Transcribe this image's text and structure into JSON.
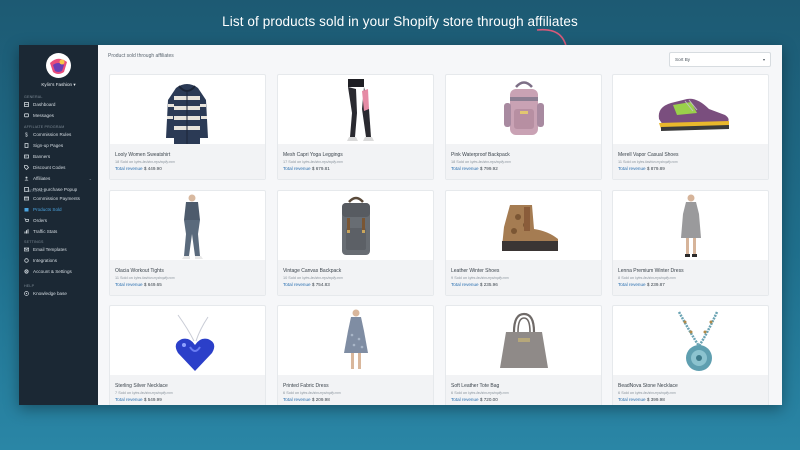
{
  "headline": "List of products sold in your Shopify store through affiliates",
  "sidebar": {
    "store_name": "Kylin's Fashion ▾",
    "sections": [
      {
        "title": "GENERAL",
        "items": [
          {
            "label": "Dashboard",
            "icon": "dashboard-icon",
            "active": false
          },
          {
            "label": "Messages",
            "icon": "message-icon",
            "active": false
          }
        ]
      },
      {
        "title": "AFFILIATE PROGRAM",
        "items": [
          {
            "label": "Commission Rules",
            "icon": "dollar-icon",
            "active": false
          },
          {
            "label": "Sign-up Pages",
            "icon": "page-icon",
            "active": false
          },
          {
            "label": "Banners",
            "icon": "image-icon",
            "active": false
          },
          {
            "label": "Discount Codes",
            "icon": "tag-icon",
            "active": false
          },
          {
            "label": "Affiliates",
            "icon": "users-icon",
            "active": false,
            "chevron": "⌄"
          },
          {
            "label": "Post-purchase Popup",
            "icon": "popup-icon",
            "active": false
          }
        ]
      },
      {
        "title": "STATISTICS",
        "items": [
          {
            "label": "Commission Payments",
            "icon": "card-icon",
            "active": false
          },
          {
            "label": "Products Sold",
            "icon": "box-icon",
            "active": true
          },
          {
            "label": "Orders",
            "icon": "cart-icon",
            "active": false
          },
          {
            "label": "Traffic Stats",
            "icon": "chart-icon",
            "active": false
          }
        ]
      },
      {
        "title": "SETTINGS",
        "items": [
          {
            "label": "Email Templates",
            "icon": "mail-icon",
            "active": false
          },
          {
            "label": "Integrations",
            "icon": "plug-icon",
            "active": false
          },
          {
            "label": "Account & Settings",
            "icon": "gear-icon",
            "active": false
          }
        ]
      },
      {
        "title": "HELP",
        "items": [
          {
            "label": "Knowledge base",
            "icon": "help-icon",
            "active": false
          }
        ]
      }
    ]
  },
  "main": {
    "title": "Product sold through affiliates",
    "sort_label": "Sort By",
    "sort_caret": "▾",
    "sold_suffix": "Sold on",
    "site": "kyles-fashion.myshopify.com",
    "revenue_label": "Total revenue",
    "products": [
      {
        "name": "Looly Women Sweatshirt",
        "sold": "18",
        "revenue": "$ 449.90",
        "kind": "hoodie"
      },
      {
        "name": "Mesh Capri Yoga Leggings",
        "sold": "17",
        "revenue": "$ 679.81",
        "kind": "leggings"
      },
      {
        "name": "Pink Waterproof Backpack",
        "sold": "18",
        "revenue": "$ 799.92",
        "kind": "pinkbag"
      },
      {
        "name": "Merell Vapor Casual Shoes",
        "sold": "11",
        "revenue": "$ 879.89",
        "kind": "sneaker"
      },
      {
        "name": "Olacia Workout Tights",
        "sold": "11",
        "revenue": "$ 649.65",
        "kind": "tights"
      },
      {
        "name": "Vintage Canvas Backpack",
        "sold": "10",
        "revenue": "$ 754.83",
        "kind": "greybag"
      },
      {
        "name": "Leather Winter Shoes",
        "sold": "9",
        "revenue": "$ 235.96",
        "kind": "boot"
      },
      {
        "name": "Lenna Premium Winter Dress",
        "sold": "8",
        "revenue": "$ 239.87",
        "kind": "greydress"
      },
      {
        "name": "Sterling Silver Necklace",
        "sold": "7",
        "revenue": "$ 549.99",
        "kind": "heart"
      },
      {
        "name": "Printed Fabric Dress",
        "sold": "6",
        "revenue": "$ 209.98",
        "kind": "printdress"
      },
      {
        "name": "Soft Leather Tote Bag",
        "sold": "6",
        "revenue": "$ 720.00",
        "kind": "tote"
      },
      {
        "name": "BeadNova Stone Necklace",
        "sold": "6",
        "revenue": "$ 399.98",
        "kind": "beads"
      }
    ]
  },
  "colors": {
    "accent": "#4aa3df",
    "sidebar": "#1b2834",
    "revenue": "#2a6fb0"
  }
}
